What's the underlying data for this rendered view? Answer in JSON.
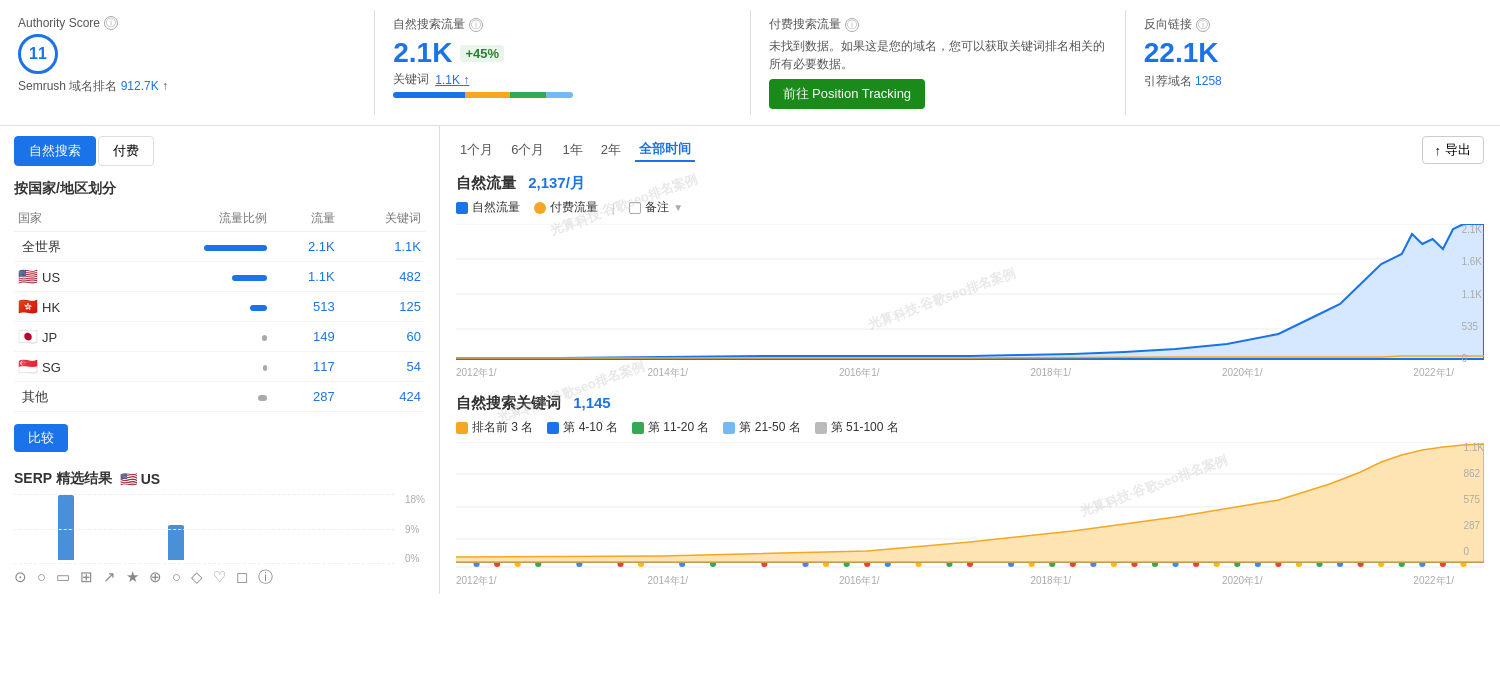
{
  "topMetrics": {
    "authorityScore": {
      "label": "Authority Score",
      "value": "11",
      "circleValue": "11"
    },
    "organicTraffic": {
      "label": "自然搜索流量",
      "value": "2.1K",
      "badge": "+45%",
      "subLabel": "关键词",
      "subValue": "1.1K",
      "subArrow": "↑"
    },
    "paidTraffic": {
      "label": "付费搜索流量",
      "note": "未找到数据。如果这是您的域名，您可以获取关键词排名相关的所有必要数据。",
      "btnLabel": "前往 Position Tracking"
    },
    "backlinks": {
      "label": "反向链接",
      "value": "22.1K",
      "subLabel": "引荐域名",
      "subValue": "1258"
    }
  },
  "leftPanel": {
    "tabs": [
      "自然搜索",
      "付费"
    ],
    "activeTab": "自然搜索",
    "regionTitle": "按国家/地区划分",
    "tableHeaders": [
      "国家",
      "流量比例",
      "流量",
      "关键词"
    ],
    "tableRows": [
      {
        "name": "全世界",
        "flag": "",
        "pct": "100%",
        "traffic": "2.1K",
        "keywords": "1.1K",
        "barWidth": 90,
        "barColor": "#1a73e8"
      },
      {
        "name": "US",
        "flag": "🇺🇸",
        "pct": "50%",
        "traffic": "1.1K",
        "keywords": "482",
        "barWidth": 50,
        "barColor": "#1a73e8"
      },
      {
        "name": "HK",
        "flag": "🇭🇰",
        "pct": "24%",
        "traffic": "513",
        "keywords": "125",
        "barWidth": 24,
        "barColor": "#1a73e8"
      },
      {
        "name": "JP",
        "flag": "🇯🇵",
        "pct": "7%",
        "traffic": "149",
        "keywords": "60",
        "barWidth": 7,
        "barColor": "#aaa"
      },
      {
        "name": "SG",
        "flag": "🇸🇬",
        "pct": "5.5%",
        "traffic": "117",
        "keywords": "54",
        "barWidth": 5,
        "barColor": "#aaa"
      },
      {
        "name": "其他",
        "flag": "",
        "pct": "13%",
        "traffic": "287",
        "keywords": "424",
        "barWidth": 13,
        "barColor": "#aaa"
      }
    ],
    "compareBtnLabel": "比较",
    "serpTitle": "SERP 精选结果",
    "serpFlag": "🇺🇸 US",
    "serpYLabels": [
      "18%",
      "9%",
      "0%"
    ],
    "serpBars": [
      {
        "height": 0
      },
      {
        "height": 0
      },
      {
        "height": 65
      },
      {
        "height": 0
      },
      {
        "height": 0
      },
      {
        "height": 0
      },
      {
        "height": 0
      },
      {
        "height": 35
      },
      {
        "height": 0
      },
      {
        "height": 0
      },
      {
        "height": 0
      },
      {
        "height": 0
      }
    ]
  },
  "rightPanel": {
    "timeButtons": [
      "1个月",
      "6个月",
      "1年",
      "2年",
      "全部时间"
    ],
    "activeTime": "全部时间",
    "exportLabel": "导出",
    "trafficTitle": "自然流量",
    "trafficValue": "2,137/月",
    "legend": {
      "organic": "自然流量",
      "paid": "付费流量",
      "notes": "备注"
    },
    "xLabels": [
      "2012年1/",
      "2014年1/",
      "2016年1/",
      "2018年1/",
      "2020年1/",
      "2022年1/"
    ],
    "yLabels": [
      "2.1K",
      "1.6K",
      "1.1K",
      "535",
      "0"
    ],
    "keywordTitle": "自然搜索关键词",
    "keywordCount": "1,145",
    "keywordLegend": [
      {
        "label": "排名前 3 名",
        "color": "#f5a623"
      },
      {
        "label": "第 4-10 名",
        "color": "#1a73e8"
      },
      {
        "label": "第 11-20 名",
        "color": "#34a853"
      },
      {
        "label": "第 21-50 名",
        "color": "#74b9f5"
      },
      {
        "label": "第 51-100 名",
        "color": "#bbb"
      }
    ],
    "kwXLabels": [
      "2012年1/",
      "2014年1/",
      "2016年1/",
      "2018年1/",
      "2020年1/",
      "2022年1/"
    ],
    "kwYLabels": [
      "1.1K",
      "862",
      "575",
      "287",
      "0"
    ]
  },
  "watermarkText": "光算科技·谷歌seo排名案例"
}
